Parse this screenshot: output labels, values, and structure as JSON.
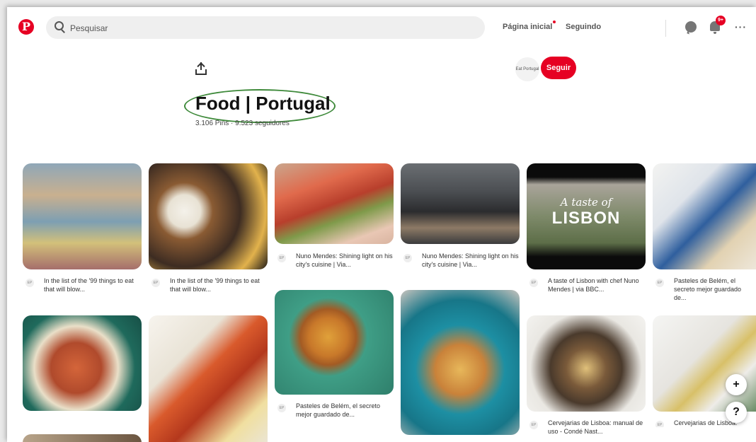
{
  "header": {
    "search_placeholder": "Pesquisar",
    "nav_home": "Página inicial",
    "nav_following": "Seguindo",
    "notification_count": "9+",
    "more": "···"
  },
  "board": {
    "title": "Food | Portugal",
    "stats": "3.106 Pins · 9.523 seguidores",
    "follow_label": "Seguir",
    "owner_avatar_text": "Eat Portugal"
  },
  "pins": [
    {
      "caption": "In the list of the '99 things to eat that will blow..."
    },
    {
      "caption": "In the list of the '99 things to eat that will blow..."
    },
    {
      "caption": "Nuno Mendes: Shining light on his city's cuisine | Via..."
    },
    {
      "caption": "Nuno Mendes: Shining light on his city's cuisine | Via..."
    },
    {
      "caption": "A taste of Lisbon with chef Nuno Mendes | via BBC..."
    },
    {
      "caption": "Pasteles de Belém, el secreto mejor guardado de..."
    },
    {
      "caption": "Pasteles de Belém, el secreto mejor guardado de..."
    },
    {
      "caption": "Cervejarias de Lisboa: manual de uso - Condé Nast..."
    },
    {
      "caption": "Cervejarias de Lisboa: manual de uso - Condé Nast..."
    }
  ],
  "pin_overlay": {
    "line1": "A taste of",
    "line2": "LISBON"
  },
  "fab": {
    "add": "+",
    "help": "?"
  },
  "caption_avatar_text": "EP"
}
